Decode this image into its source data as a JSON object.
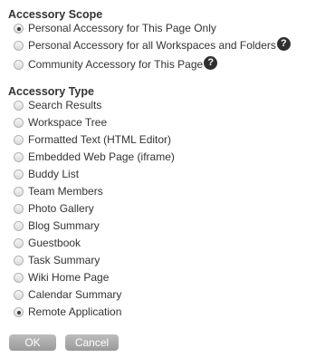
{
  "scope": {
    "heading": "Accessory Scope",
    "options": [
      {
        "label": "Personal Accessory for This Page Only",
        "checked": true,
        "help": false
      },
      {
        "label": "Personal Accessory for all Workspaces and Folders",
        "checked": false,
        "help": true
      },
      {
        "label": "Community Accessory for This Page",
        "checked": false,
        "help": true
      }
    ]
  },
  "type": {
    "heading": "Accessory Type",
    "options": [
      {
        "label": "Search Results",
        "checked": false
      },
      {
        "label": "Workspace Tree",
        "checked": false
      },
      {
        "label": "Formatted Text (HTML Editor)",
        "checked": false
      },
      {
        "label": "Embedded Web Page (iframe)",
        "checked": false
      },
      {
        "label": "Buddy List",
        "checked": false
      },
      {
        "label": "Team Members",
        "checked": false
      },
      {
        "label": "Photo Gallery",
        "checked": false
      },
      {
        "label": "Blog Summary",
        "checked": false
      },
      {
        "label": "Guestbook",
        "checked": false
      },
      {
        "label": "Task Summary",
        "checked": false
      },
      {
        "label": "Wiki Home Page",
        "checked": false
      },
      {
        "label": "Calendar Summary",
        "checked": false
      },
      {
        "label": "Remote Application",
        "checked": true
      }
    ]
  },
  "help_icon_glyph": "?",
  "buttons": {
    "ok": "OK",
    "cancel": "Cancel"
  }
}
